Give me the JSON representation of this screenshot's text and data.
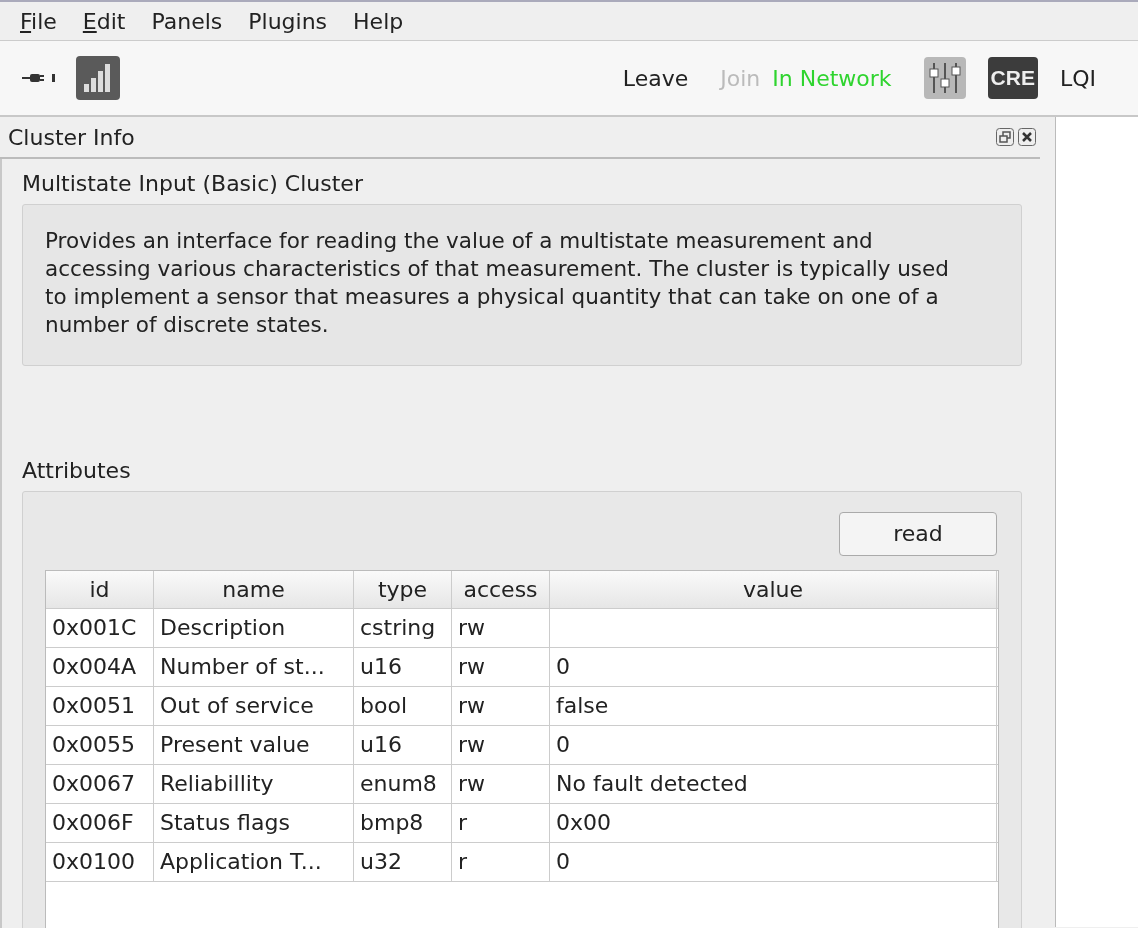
{
  "menu": [
    {
      "label": "File",
      "mnemonic": true
    },
    {
      "label": "Edit",
      "mnemonic": true
    },
    {
      "label": "Panels",
      "mnemonic": false
    },
    {
      "label": "Plugins",
      "mnemonic": false
    },
    {
      "label": "Help",
      "mnemonic": false
    }
  ],
  "toolbar": {
    "actions": [
      {
        "label": "Leave",
        "disabled": false
      },
      {
        "label": "Join",
        "disabled": true
      }
    ],
    "status": "In Network",
    "badge": "CRE",
    "lqi": "LQI"
  },
  "panel": {
    "title": "Cluster Info",
    "cluster_name": "Multistate Input (Basic) Cluster",
    "description": "Provides an interface for reading the value of a multistate measurement and accessing various characteristics of that measurement. The cluster is typically used to implement a sensor that measures a physical quantity that can take on one of a number of discrete states.",
    "attributes_label": "Attributes",
    "read_button": "read",
    "table": {
      "columns": [
        "id",
        "name",
        "type",
        "access",
        "value"
      ],
      "rows": [
        [
          "0x001C",
          "Description",
          "cstring",
          "rw",
          ""
        ],
        [
          "0x004A",
          "Number of st...",
          "u16",
          "rw",
          "0"
        ],
        [
          "0x0051",
          "Out of service",
          "bool",
          "rw",
          "false"
        ],
        [
          "0x0055",
          "Present value",
          "u16",
          "rw",
          "0"
        ],
        [
          "0x0067",
          "Reliabillity",
          "enum8",
          "rw",
          "No fault detected"
        ],
        [
          "0x006F",
          "Status flags",
          "bmp8",
          "r",
          "0x00"
        ],
        [
          "0x0100",
          "Application T...",
          "u32",
          "r",
          "0"
        ]
      ]
    }
  }
}
